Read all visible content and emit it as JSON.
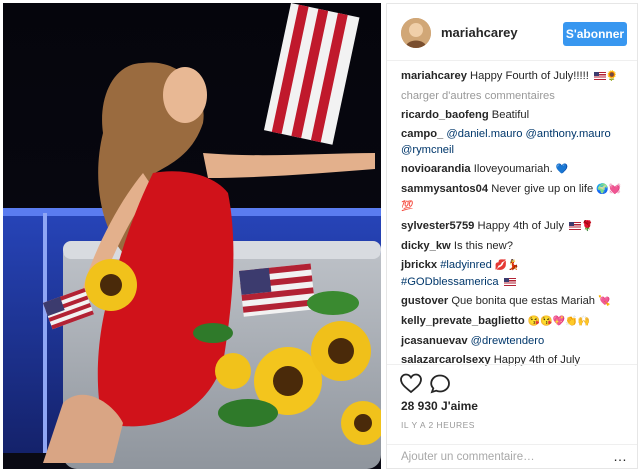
{
  "post": {
    "username": "mariahcarey",
    "follow_label": "S'abonner"
  },
  "comments": {
    "caption": {
      "user": "mariahcarey",
      "text": "Happy Fourth of July!!!!!"
    },
    "load_more": "charger d'autres commentaires",
    "items": [
      {
        "user": "ricardo_baofeng",
        "text": "Beatiful"
      },
      {
        "user": "campo_",
        "text": "@daniel.mauro @anthony.mauro @rymcneil"
      },
      {
        "user": "novioarandia",
        "text": "Iloveyoumariah."
      },
      {
        "user": "sammysantos04",
        "text": "Never give up on life"
      },
      {
        "user": "sylvester5759",
        "text": "Happy 4th of July"
      },
      {
        "user": "dicky_kw",
        "text": "Is this new?"
      },
      {
        "user": "jbrickx",
        "text": "#ladyinred"
      },
      {
        "user": "",
        "text": "#GODblessamerica"
      },
      {
        "user": "gustover",
        "text": "Que bonita que estas Mariah"
      },
      {
        "user": "kelly_prevate_baglietto",
        "text": ""
      },
      {
        "user": "jcasanuevav",
        "text": "@drewtendero"
      },
      {
        "user": "salazarcarolsexy",
        "text": "Happy 4th of July"
      }
    ]
  },
  "stats": {
    "likes": "28 930 J'aime",
    "time": "IL Y A 2 HEURES"
  },
  "add_comment": {
    "placeholder": "Ajouter un commentaire…",
    "more": "…"
  },
  "icons": [
    "heart-icon",
    "comment-icon",
    "more-icon"
  ],
  "colors": {
    "follow_button": "#3897f0",
    "dress": "#d0121a"
  }
}
